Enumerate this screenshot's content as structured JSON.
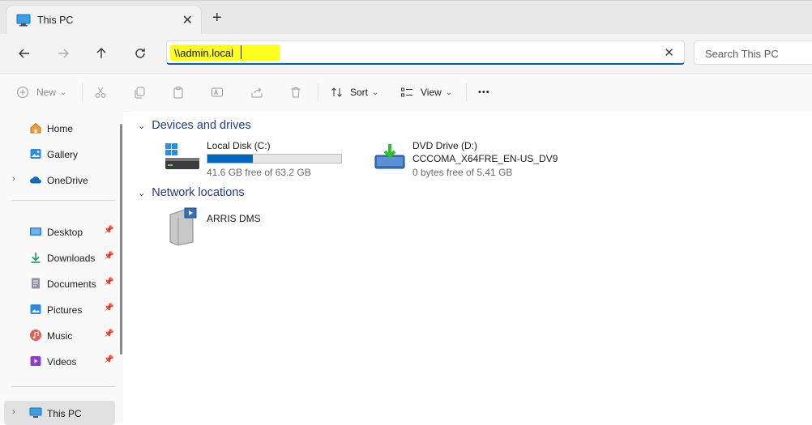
{
  "window": {
    "tab_title": "This PC",
    "tab_close": "✕",
    "new_tab": "+"
  },
  "nav": {
    "back": "←",
    "forward": "→",
    "up": "↑",
    "refresh": "↻",
    "address_value": "\\\\admin.local",
    "address_clear": "✕",
    "search_placeholder": "Search This PC"
  },
  "toolbar": {
    "new_label": "New",
    "sort_label": "Sort",
    "view_label": "View",
    "more_label": "•••",
    "dropdown_caret": "⌄"
  },
  "sidebar": {
    "items": [
      {
        "label": "Home",
        "icon": "home-icon"
      },
      {
        "label": "Gallery",
        "icon": "gallery-icon"
      },
      {
        "label": "OneDrive",
        "icon": "onedrive-icon"
      },
      {
        "label": "Desktop",
        "icon": "desktop-icon"
      },
      {
        "label": "Downloads",
        "icon": "downloads-icon"
      },
      {
        "label": "Documents",
        "icon": "documents-icon"
      },
      {
        "label": "Pictures",
        "icon": "pictures-icon"
      },
      {
        "label": "Music",
        "icon": "music-icon"
      },
      {
        "label": "Videos",
        "icon": "videos-icon"
      },
      {
        "label": "This PC",
        "icon": "this-pc-icon"
      }
    ],
    "pin_glyph": "📌",
    "expand_glyph": "›"
  },
  "content": {
    "groups": [
      {
        "title": "Devices and drives",
        "items": [
          {
            "name": "Local Disk (C:)",
            "detail": "41.6 GB free of 63.2 GB",
            "used_fraction": 0.34
          },
          {
            "name": "DVD Drive (D:)",
            "volume": "CCCOMA_X64FRE_EN-US_DV9",
            "detail": "0 bytes free of 5.41 GB"
          }
        ]
      },
      {
        "title": "Network locations",
        "items": [
          {
            "name": "ARRIS DMS"
          }
        ]
      }
    ],
    "group_chevron": "⌄"
  },
  "colors": {
    "accent": "#005fb8",
    "highlight": "#ffff22",
    "group_title": "#1f3c88",
    "drive_bar": "#0067c0"
  }
}
